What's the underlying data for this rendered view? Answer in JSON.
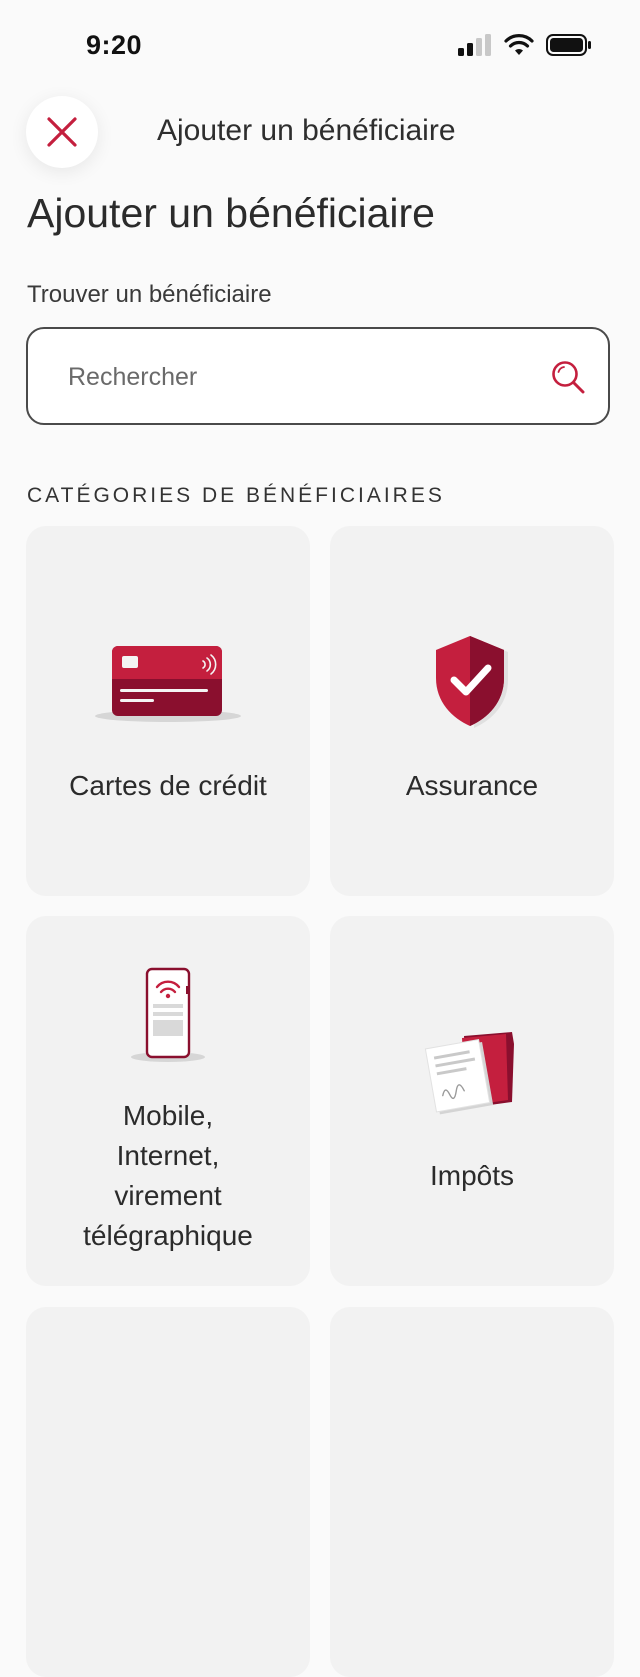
{
  "status_bar": {
    "time": "9:20"
  },
  "header": {
    "nav_title": "Ajouter un bénéficiaire"
  },
  "page": {
    "title": "Ajouter un bénéficiaire",
    "search_label": "Trouver un bénéficiaire",
    "search_placeholder": "Rechercher",
    "section_heading": "CATÉGORIES DE BÉNÉFICIAIRES"
  },
  "categories": [
    {
      "label": "Cartes de crédit",
      "icon": "credit-card-icon"
    },
    {
      "label": "Assurance",
      "icon": "shield-check-icon"
    },
    {
      "label": "Mobile,\nInternet,\nvirement\ntélégraphique",
      "icon": "mobile-phone-icon"
    },
    {
      "label": "Impôts",
      "icon": "tax-documents-icon"
    }
  ],
  "colors": {
    "brand_red": "#c41f3e",
    "brand_dark_red": "#8a0f2e",
    "tile_bg": "#f2f2f2"
  }
}
